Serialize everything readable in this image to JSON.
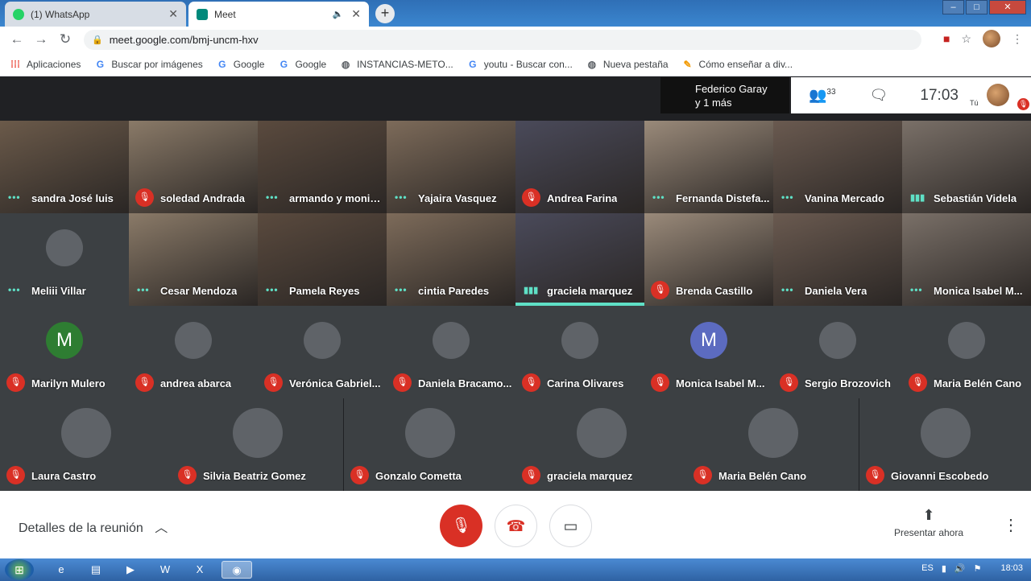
{
  "browser": {
    "tabs": [
      {
        "label": "(1) WhatsApp",
        "icon": "whatsapp-icon",
        "color": "#25d366"
      },
      {
        "label": "Meet",
        "icon": "meet-icon",
        "color": "#00897b"
      }
    ],
    "url": "meet.google.com/bmj-uncm-hxv",
    "bookmarks": [
      {
        "label": "Aplicaciones",
        "icon": "apps-grid-icon"
      },
      {
        "label": "Buscar por imágenes",
        "icon": "google-icon"
      },
      {
        "label": "Google",
        "icon": "google-icon"
      },
      {
        "label": "Google",
        "icon": "google-icon"
      },
      {
        "label": "INSTANCIAS-METO...",
        "icon": "globe-icon"
      },
      {
        "label": "youtu - Buscar con...",
        "icon": "google-icon"
      },
      {
        "label": "Nueva pestaña",
        "icon": "globe-icon"
      },
      {
        "label": "Cómo enseñar a div...",
        "icon": "bookmark-icon"
      }
    ]
  },
  "meet": {
    "presenter": {
      "line1": "Federico Garay",
      "line2": "y 1 más"
    },
    "participants_count": "33",
    "time": "17:03",
    "self_label": "Tú",
    "tiles": [
      {
        "name": "sandra José luis",
        "status": "dots"
      },
      {
        "name": "soledad Andrada",
        "status": "muted"
      },
      {
        "name": "armando y monic...",
        "status": "dots"
      },
      {
        "name": "Yajaira Vasquez",
        "status": "dots"
      },
      {
        "name": "Andrea Farina",
        "status": "muted"
      },
      {
        "name": "Fernanda Distefa...",
        "status": "dots"
      },
      {
        "name": "Vanina Mercado",
        "status": "dots"
      },
      {
        "name": "Sebastián Videla",
        "status": "speaking"
      },
      {
        "name": "Meliii Villar",
        "status": "dots"
      },
      {
        "name": "Cesar Mendoza",
        "status": "dots"
      },
      {
        "name": "Pamela Reyes",
        "status": "dots"
      },
      {
        "name": "cintia Paredes",
        "status": "dots"
      },
      {
        "name": "graciela marquez",
        "status": "speaking"
      },
      {
        "name": "Brenda Castillo",
        "status": "muted"
      },
      {
        "name": "Daniela Vera",
        "status": "dots"
      },
      {
        "name": "Monica Isabel M...",
        "status": "dots"
      },
      {
        "name": "Marilyn Mulero",
        "status": "muted",
        "avatar_letter": "M"
      },
      {
        "name": "andrea abarca",
        "status": "muted"
      },
      {
        "name": "Verónica Gabriel...",
        "status": "muted"
      },
      {
        "name": "Daniela Bracamo...",
        "status": "muted"
      },
      {
        "name": "Carina Olivares",
        "status": "muted"
      },
      {
        "name": "Monica Isabel M...",
        "status": "muted",
        "avatar_letter": "M"
      },
      {
        "name": "Sergio Brozovich",
        "status": "muted"
      },
      {
        "name": "Maria Belén Cano",
        "status": "muted"
      },
      {
        "name": "Laura Castro",
        "status": "muted"
      },
      {
        "name": "Silvia Beatriz Gomez",
        "status": "muted"
      },
      {
        "name": "Gonzalo Cometta",
        "status": "muted"
      },
      {
        "name": "graciela marquez",
        "status": "muted"
      },
      {
        "name": "Maria Belén Cano",
        "status": "muted"
      },
      {
        "name": "Giovanni Escobedo",
        "status": "muted"
      }
    ],
    "details_label": "Detalles de la reunión",
    "present_label": "Presentar ahora"
  },
  "taskbar": {
    "language": "ES",
    "clock": "18:03"
  }
}
